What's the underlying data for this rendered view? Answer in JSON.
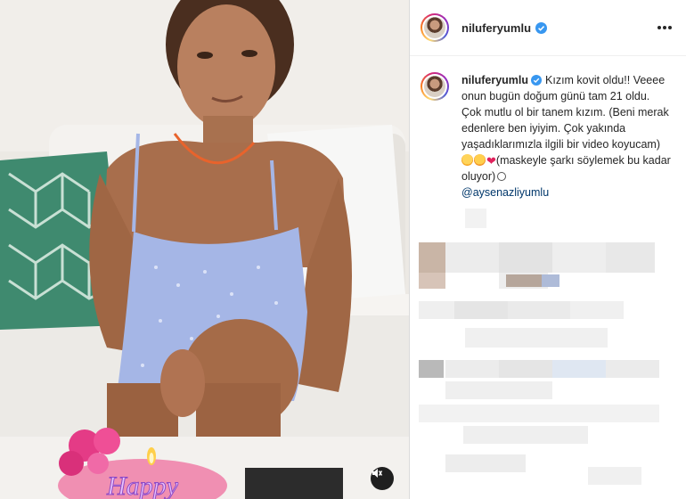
{
  "post": {
    "username": "niluferyumlu",
    "verified": true,
    "caption": {
      "line1": "Kızım kovit oldu!!",
      "line2": "Veeee onun bugün doğum günü tam 21 oldu. Çok mutlu ol bir tanem kızım. (Beni merak edenlere ben iyiyim. Çok yakında yaşadıklarımızla ilgili bir video koyucam)",
      "line3": "(maskeyle şarkı söylemek bu kadar oluyor)",
      "mention": "@aysenazliyumlu"
    }
  },
  "icons": {
    "verified": "verified-badge-icon",
    "more": "more-options-icon",
    "mute": "audio-muted-icon",
    "emojis": [
      "grinning-sweat-emoji",
      "heart-eyes-emoji",
      "red-heart-emoji",
      "smile-emoji"
    ]
  },
  "colors": {
    "verified": "#3897f0",
    "mention": "#00376b",
    "heart": "#e0245e",
    "border": "#dbdbdb"
  }
}
